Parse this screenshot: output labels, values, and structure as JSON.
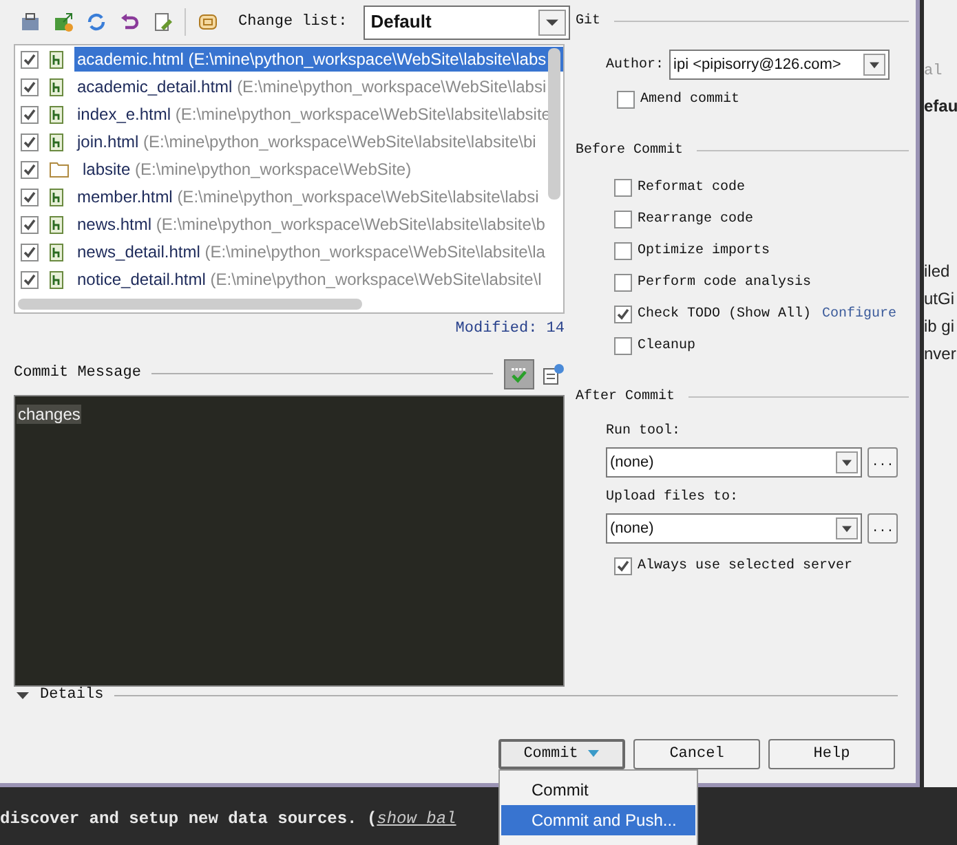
{
  "toolbar": {
    "change_list_label": "Change list:",
    "change_list_value": "Default"
  },
  "files": [
    {
      "name": "academic.html",
      "path": "(E:\\mine\\python_workspace\\WebSite\\labsite\\labs",
      "kind": "file",
      "checked": true,
      "selected": true
    },
    {
      "name": "academic_detail.html",
      "path": "(E:\\mine\\python_workspace\\WebSite\\labsi",
      "kind": "file",
      "checked": true,
      "selected": false
    },
    {
      "name": "index_e.html",
      "path": "(E:\\mine\\python_workspace\\WebSite\\labsite\\labsite",
      "kind": "file",
      "checked": true,
      "selected": false
    },
    {
      "name": "join.html",
      "path": "(E:\\mine\\python_workspace\\WebSite\\labsite\\labsite\\bi",
      "kind": "file",
      "checked": true,
      "selected": false
    },
    {
      "name": "labsite",
      "path": "(E:\\mine\\python_workspace\\WebSite)",
      "kind": "folder",
      "checked": true,
      "selected": false
    },
    {
      "name": "member.html",
      "path": "(E:\\mine\\python_workspace\\WebSite\\labsite\\labsi",
      "kind": "file",
      "checked": true,
      "selected": false
    },
    {
      "name": "news.html",
      "path": "(E:\\mine\\python_workspace\\WebSite\\labsite\\labsite\\b",
      "kind": "file",
      "checked": true,
      "selected": false
    },
    {
      "name": "news_detail.html",
      "path": "(E:\\mine\\python_workspace\\WebSite\\labsite\\la",
      "kind": "file",
      "checked": true,
      "selected": false
    },
    {
      "name": "notice_detail.html",
      "path": "(E:\\mine\\python_workspace\\WebSite\\labsite\\l",
      "kind": "file",
      "checked": true,
      "selected": false
    }
  ],
  "modified": "Modified: 14",
  "commit_message": {
    "label": "Commit Message",
    "value": "changes"
  },
  "details": {
    "label": "Details",
    "expanded": true
  },
  "git": {
    "title": "Git",
    "author_label": "Author:",
    "author_value": "ipi <pipisorry@126.com>",
    "amend": {
      "label": "Amend commit",
      "checked": false
    }
  },
  "before_commit": {
    "title": "Before Commit",
    "options": [
      {
        "label": "Reformat code",
        "checked": false
      },
      {
        "label": "Rearrange code",
        "checked": false
      },
      {
        "label": "Optimize imports",
        "checked": false
      },
      {
        "label": "Perform code analysis",
        "checked": false
      },
      {
        "label": "Check TODO (Show All)",
        "checked": true,
        "link": "Configure"
      },
      {
        "label": "Cleanup",
        "checked": false
      }
    ]
  },
  "after_commit": {
    "title": "After Commit",
    "run_tool_label": "Run tool:",
    "run_tool_value": "(none)",
    "upload_label": "Upload files to:",
    "upload_value": "(none)",
    "always_use": {
      "label": "Always use selected server",
      "checked": true
    }
  },
  "buttons": [
    "Commit",
    "Cancel",
    "Help"
  ],
  "browse_buttons": [
    "...",
    "..."
  ],
  "commit_menu": [
    {
      "label": "Commit",
      "selected": false
    },
    {
      "label": "Commit and Push...",
      "selected": true
    }
  ],
  "background_ide": {
    "fragments": [
      "al",
      "efau",
      "iled",
      "utGi",
      "ib gi",
      "nver"
    ],
    "console_text": "discover and setup new data sources. (",
    "console_link": "show bal"
  }
}
